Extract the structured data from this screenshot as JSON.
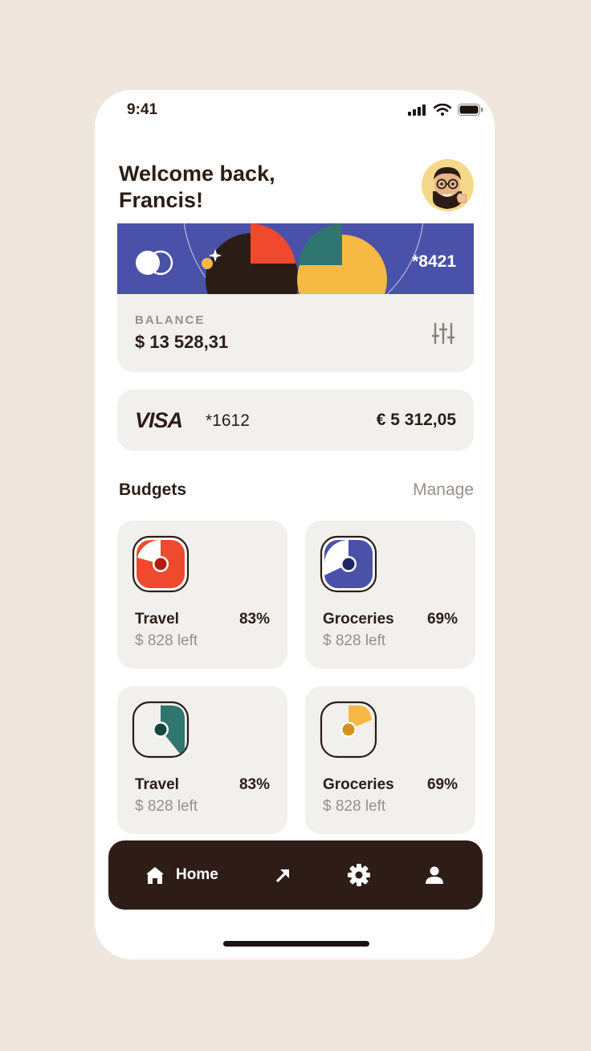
{
  "status_bar": {
    "time": "9:41"
  },
  "header": {
    "greeting_line1": "Welcome back,",
    "greeting_line2": "Francis!"
  },
  "card": {
    "masked_number": "*8421",
    "balance_label": "BALANCE",
    "balance_value": "$ 13 528,31"
  },
  "visa": {
    "brand": "VISA",
    "masked_number": "*1612",
    "amount": "€ 5 312,05"
  },
  "budgets": {
    "title": "Budgets",
    "manage_label": "Manage",
    "items": [
      {
        "name": "Travel",
        "percent": "83%",
        "left": "$ 828 left",
        "color": "#f04a2e",
        "fill": 0.83
      },
      {
        "name": "Groceries",
        "percent": "69%",
        "left": "$ 828 left",
        "color": "#4a51a8",
        "fill": 0.69
      },
      {
        "name": "Travel",
        "percent": "83%",
        "left": "$ 828 left",
        "color": "#2f7670",
        "fill": 0.35
      },
      {
        "name": "Groceries",
        "percent": "69%",
        "left": "$ 828 left",
        "color": "#f6b944",
        "fill": 0.2
      }
    ]
  },
  "tab_bar": {
    "items": [
      {
        "label": "Home",
        "icon": "home-icon",
        "active": true
      },
      {
        "label": "",
        "icon": "arrow-up-right-icon",
        "active": false
      },
      {
        "label": "",
        "icon": "gear-icon",
        "active": false
      },
      {
        "label": "",
        "icon": "user-icon",
        "active": false
      }
    ]
  },
  "colors": {
    "accent_blue": "#4a51a8",
    "accent_red": "#f04a2e",
    "accent_teal": "#2f7670",
    "accent_yellow": "#f6b944",
    "dark": "#2e1d16",
    "card_bg": "#f2f0ec"
  }
}
